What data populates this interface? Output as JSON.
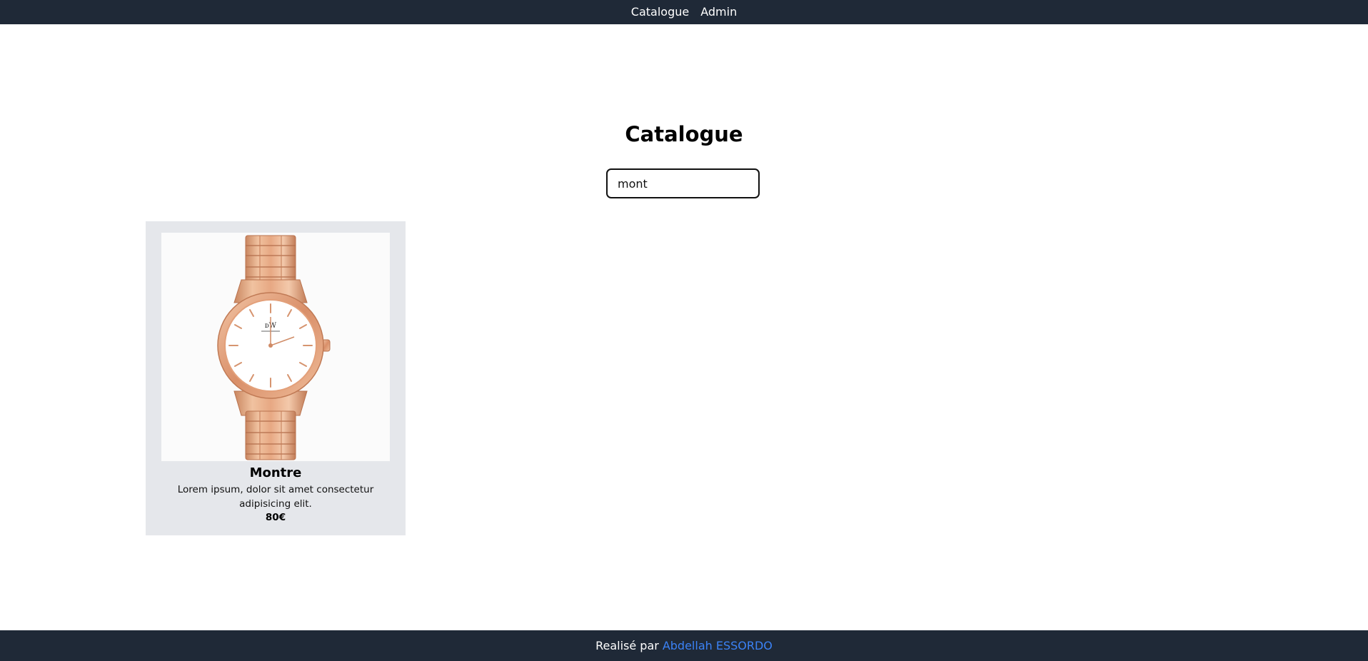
{
  "nav": {
    "items": [
      {
        "label": "Catalogue"
      },
      {
        "label": "Admin"
      }
    ]
  },
  "main": {
    "title": "Catalogue",
    "search": {
      "value": "mont",
      "placeholder": ""
    },
    "products": [
      {
        "name": "Montre",
        "description": "Lorem ipsum, dolor sit amet consectetur adipisicing elit.",
        "price": "80€",
        "image_icon": "watch-image"
      }
    ]
  },
  "footer": {
    "prefix": "Realisé par",
    "author": "Abdellah ESSORDO"
  },
  "colors": {
    "nav_bg": "#1f2937",
    "card_bg": "#e5e7eb",
    "link": "#3b82f6",
    "watch_gold": "#e6a985"
  }
}
